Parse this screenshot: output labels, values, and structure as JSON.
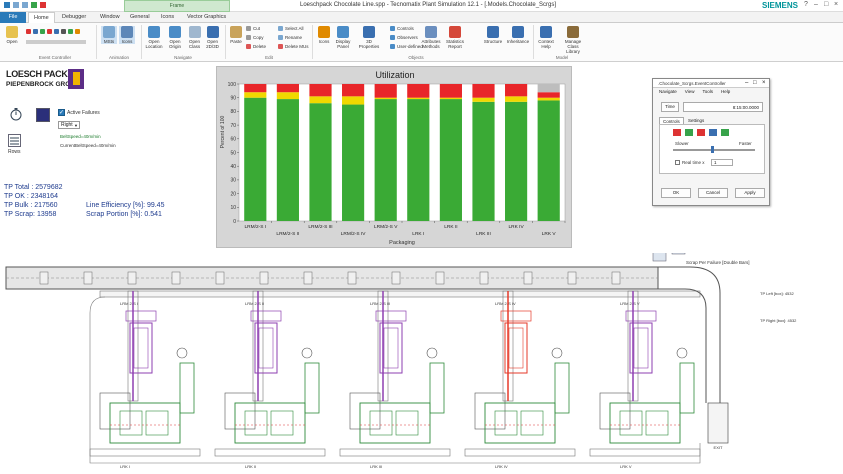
{
  "window": {
    "title": "Loeschpack Chocolate Line.spp - Tecnomatix Plant Simulation 12.1 - [.Models.Chocolate_Scrgs]",
    "brand": "SIEMENS",
    "context_tab": "Frame"
  },
  "tabs": [
    "File",
    "Home",
    "Debugger",
    "Window",
    "General",
    "Icons",
    "Vector Graphics"
  ],
  "ribbon": {
    "open": "Open",
    "event_controller_group": "Event Controller",
    "animation_group": "Animation",
    "navigate_group": "Navigate",
    "edit_group": "Edit",
    "objects_group": "Objects",
    "model_group": "Model",
    "msts": "MSts",
    "icons": "Icons",
    "open_location": "Open Location",
    "open_origin": "Open Origin",
    "open_class": "Open Class",
    "open_2d3d": "Open 2D/3D",
    "paste": "Paste",
    "cut": "Cut",
    "copy": "Copy",
    "delete": "Delete",
    "select_all": "Select All",
    "rename": "Rename",
    "delete_mus": "Delete MUs",
    "icons_btn": "Icons",
    "display_panel": "Display Panel",
    "3d_properties": "3D Properties",
    "controls": "Controls",
    "observers": "Observers",
    "user_defined": "User-defined",
    "attributes_methods": "Attributes Methods",
    "statistics_report": "Statistics Report",
    "structure": "Structure",
    "inheritance": "Inheritance",
    "context_help": "Context Help",
    "manage_class_library": "Manage Class Library"
  },
  "logo": {
    "line1": "LOESCH PACK",
    "line2": "PIEPENBROCK GROUP"
  },
  "controls": {
    "active_failures": "Active Failures",
    "dropdown": "Right",
    "belt_speed": "BeltSpeed=40m/min",
    "current_belt_speed": "CurrentBeltSpeed=40m/min",
    "rows": "Rows"
  },
  "stats": {
    "tp_total": "TP Total : 2579682",
    "tp_ok": "TP OK    : 2348164",
    "tp_bulk": "TP Bulk  : 217560",
    "tp_scrap": "TP Scrap: 13958",
    "line_efficiency": "Line Efficiency  [%]: 99.45",
    "scrap_portion": "Scrap Portion    [%]: 0.541"
  },
  "chart_data": {
    "type": "bar",
    "title": "Utilization",
    "xlabel": "Packaging",
    "ylabel": "Percent of 100",
    "ylim": [
      0,
      100
    ],
    "yticks": [
      0,
      10,
      20,
      30,
      40,
      50,
      60,
      70,
      80,
      90,
      100
    ],
    "categories": [
      "LRM/2-S I",
      "LRM/2-S II",
      "LRM/2-S III",
      "LRM/2-S IV",
      "LRM/2-S V",
      "LRK I",
      "LRK II",
      "LRK III",
      "LRK IV",
      "LRK V"
    ],
    "series": [
      {
        "color": "#3aaa35",
        "values": [
          90,
          89,
          86,
          85,
          89,
          89,
          89,
          87,
          87,
          88
        ]
      },
      {
        "color": "#f0d800",
        "values": [
          4,
          5,
          5,
          6,
          1,
          1,
          1,
          3,
          4,
          2
        ]
      },
      {
        "color": "#e8262a",
        "values": [
          6,
          6,
          9,
          9,
          10,
          10,
          10,
          10,
          9,
          4
        ]
      },
      {
        "color": "#bdbdbd",
        "values": [
          0,
          0,
          0,
          0,
          0,
          0,
          0,
          0,
          0,
          6
        ]
      }
    ]
  },
  "dialog": {
    "title": ".Chocolate_Scrgs.EventController",
    "menu": [
      "Navigate",
      "View",
      "Tools",
      "Help"
    ],
    "time_label": "Time",
    "time_value": "8:15:00.0000",
    "tab_controls": "Controls",
    "tab_settings": "Settings",
    "slower": "Slower",
    "faster": "Faster",
    "realtime": "Real time x",
    "realtime_value": "1",
    "ok": "OK",
    "cancel": "Cancel",
    "apply": "Apply"
  },
  "plant": {
    "scrap_per_failure": "Scrap Per Failure [Double Bars]",
    "tp_left": "TP Left [box]: 4532",
    "tp_right": "TP Right [box]: 4532",
    "units": [
      "LRM 2-S I",
      "LRM 2-S II",
      "LRM 2-S III",
      "LRM 2-S IV",
      "LRM 2-S V"
    ],
    "bottom_labels": [
      "LRK I",
      "LRK II",
      "LRK III",
      "LRK IV",
      "LRK V"
    ],
    "exit_label": "EXIT",
    "unit_colors": [
      "#8e3fb0",
      "#8e3fb0",
      "#8e3fb0",
      "#e53a2a",
      "#8e3fb0"
    ]
  }
}
